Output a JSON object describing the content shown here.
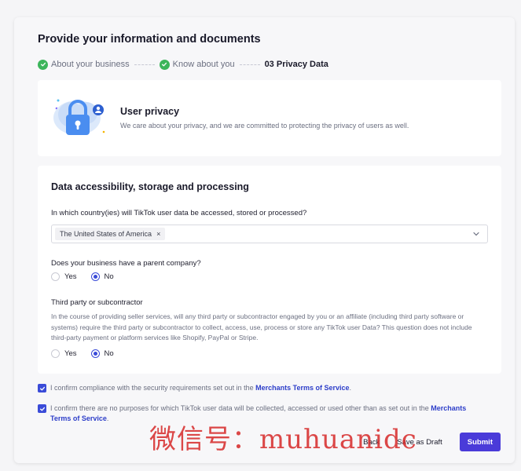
{
  "page": {
    "title": "Provide your information and documents"
  },
  "steps": [
    {
      "label": "About your business",
      "state": "done"
    },
    {
      "label": "Know about you",
      "state": "done"
    },
    {
      "label": "03 Privacy Data",
      "state": "current"
    }
  ],
  "privacy": {
    "title": "User privacy",
    "description": "We care about your privacy, and we are committed to protecting the privacy of users as well.",
    "illustration_icon": "lock-icon"
  },
  "data_section": {
    "title": "Data accessibility, storage and processing",
    "q1": {
      "label": "In which country(ies) will TikTok user data be accessed, stored or processed?",
      "selected_tag": "The United States of America",
      "remove_glyph": "×"
    },
    "q2": {
      "label": "Does your business have a parent company?",
      "options": [
        "Yes",
        "No"
      ],
      "selected": "No"
    },
    "q3": {
      "title": "Third party or subcontractor",
      "description": "In the course of providing seller services, will any third party or subcontractor engaged by you or an affiliate (including third party software or systems) require the third party or subcontractor to collect, access, use, process or store any TikTok user Data? This question does not include third-party payment or platform services like Shopify, PayPal or Stripe.",
      "options": [
        "Yes",
        "No"
      ],
      "selected": "No"
    }
  },
  "confirmations": [
    {
      "text": "I confirm compliance with the security requirements set out in the ",
      "link": "Merchants Terms of Service",
      "suffix": ".",
      "checked": true
    },
    {
      "text": "I confirm there are no purposes for which TikTok user data will be collected, accessed or used other than as set out in the ",
      "link": "Merchants Terms of Service",
      "suffix": ".",
      "checked": true
    }
  ],
  "actions": {
    "back": "Back",
    "save_draft": "Save as Draft",
    "submit": "Submit"
  },
  "watermark": "微信号：muhuanidc",
  "colors": {
    "accent": "#3a4bd8",
    "primary_button": "#4a3bd9",
    "success": "#3cb55b",
    "link": "#2d3ec9"
  }
}
